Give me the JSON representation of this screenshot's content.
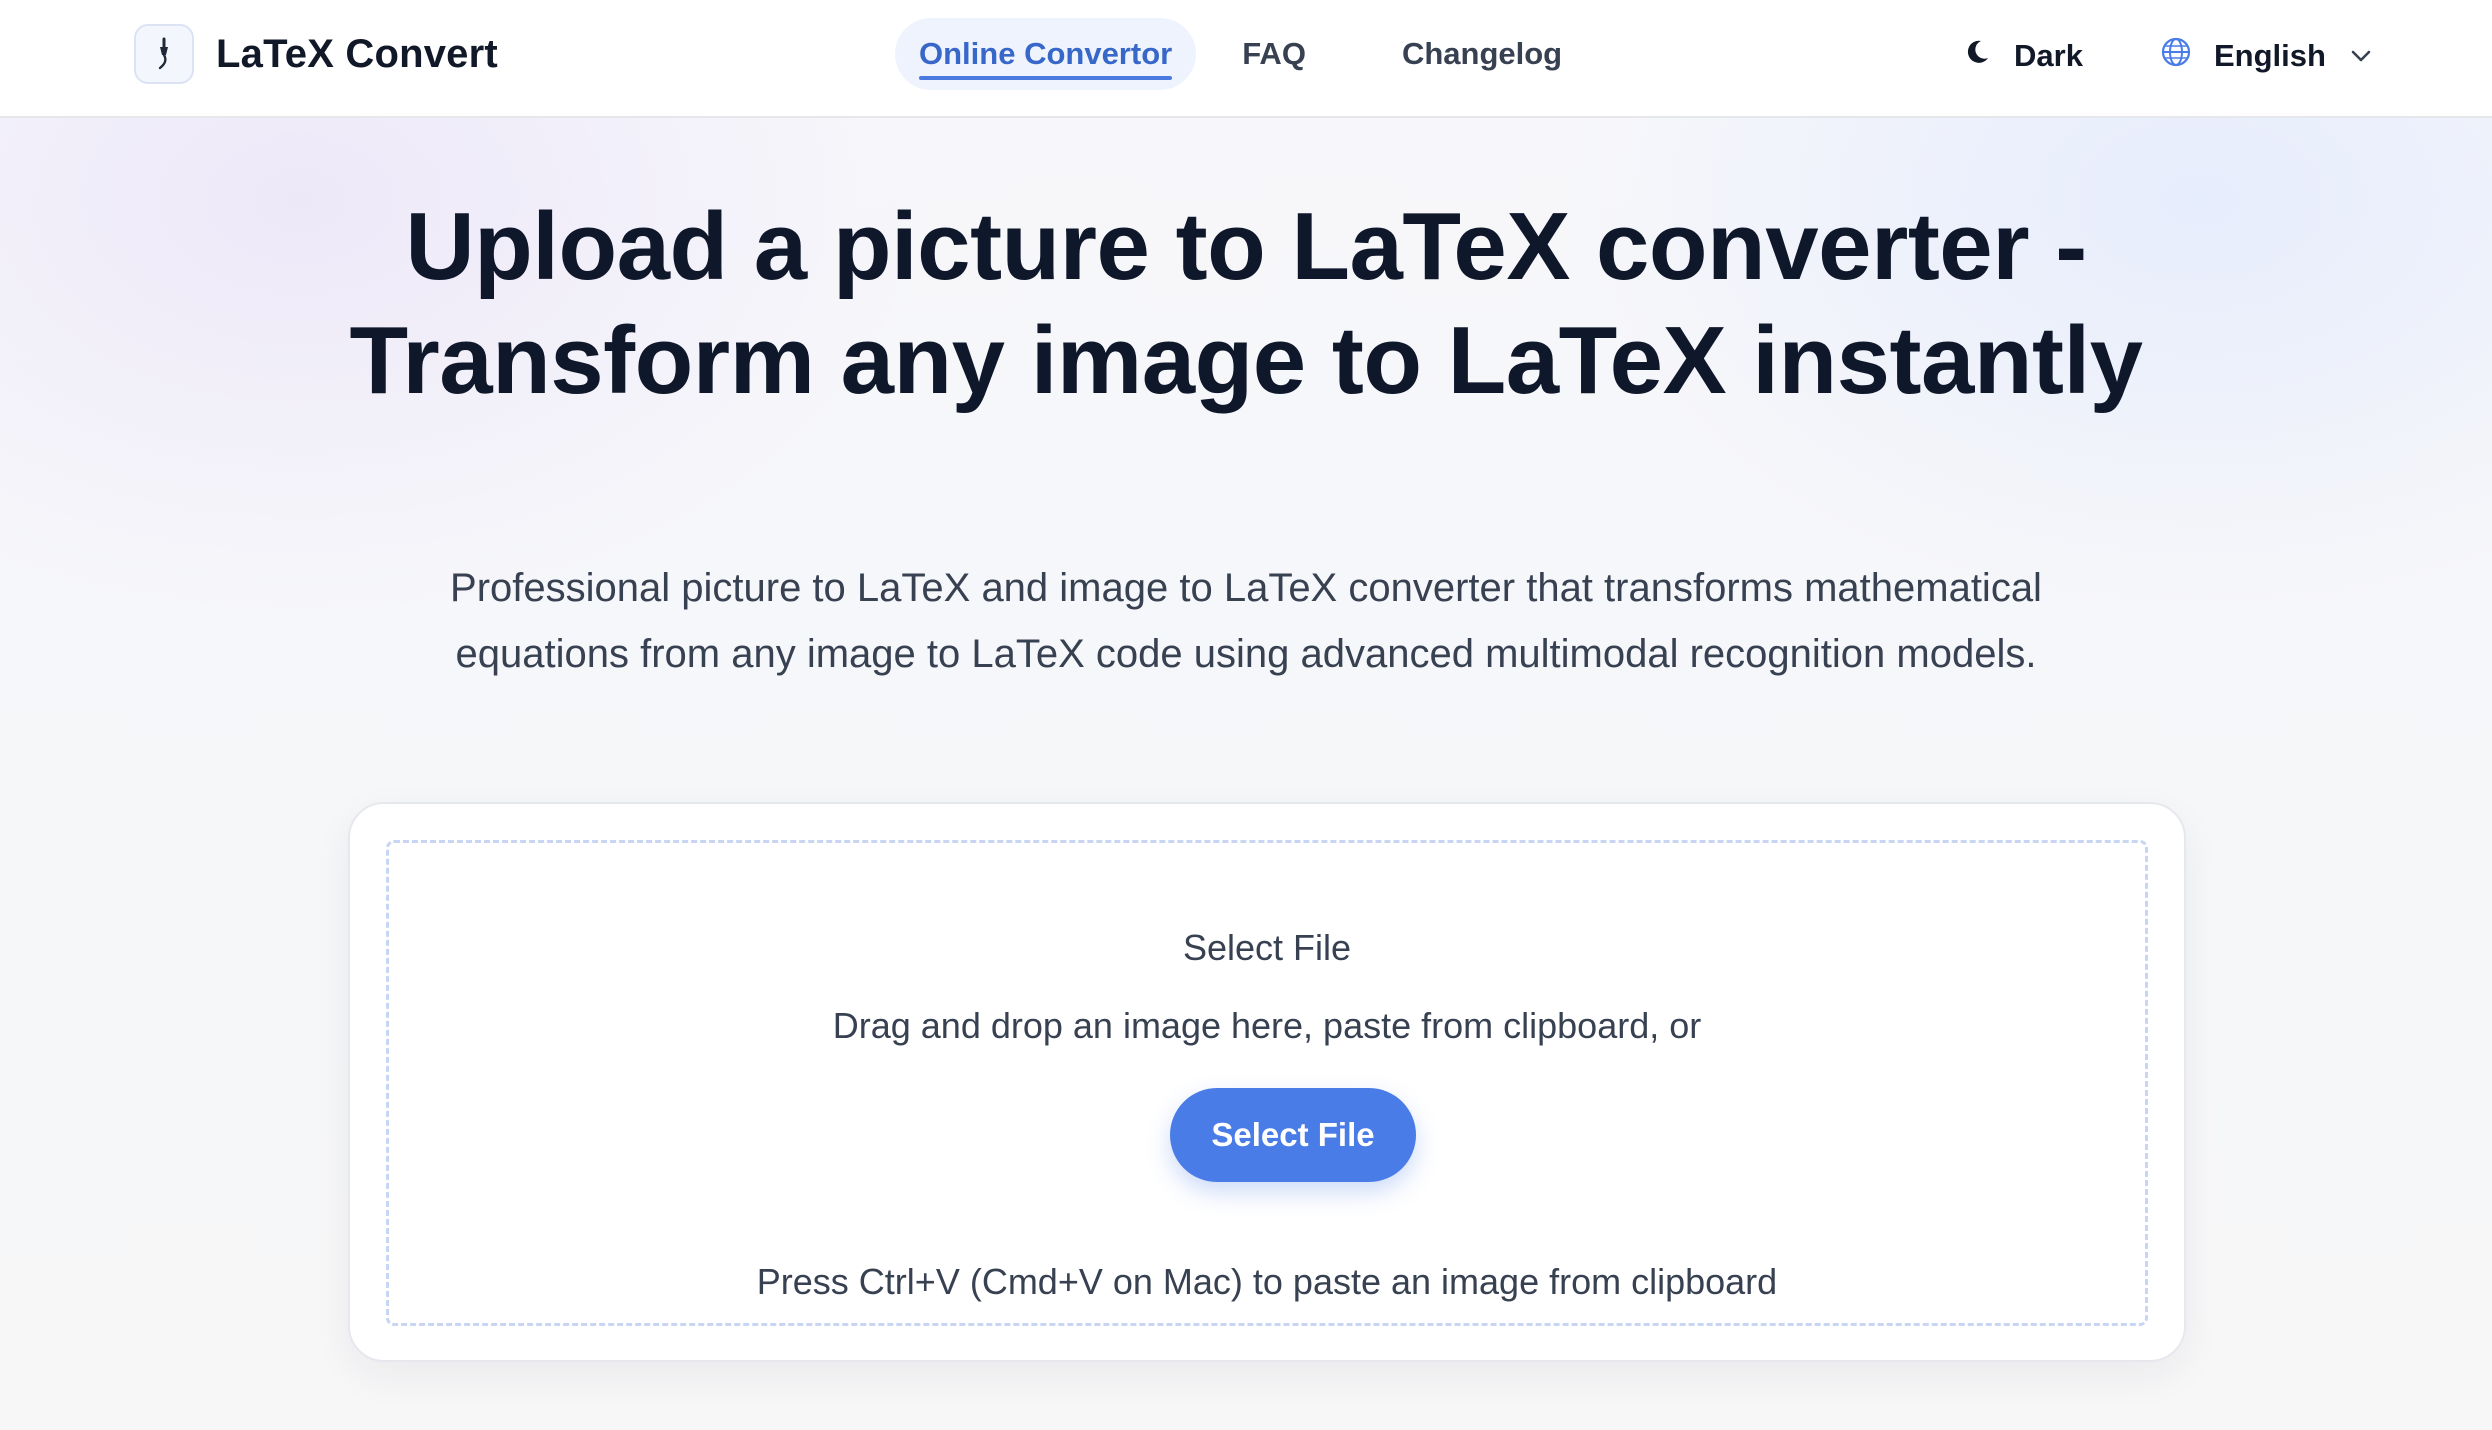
{
  "header": {
    "brand_name": "LaTeX Convert",
    "nav": [
      {
        "label": "Online Convertor",
        "active": true
      },
      {
        "label": "FAQ",
        "active": false
      },
      {
        "label": "Changelog",
        "active": false
      }
    ],
    "theme_label": "Dark",
    "language_label": "English"
  },
  "hero": {
    "title": "Upload a picture to LaTeX converter - Transform any image to LaTeX instantly",
    "subtitle": "Professional picture to LaTeX and image to LaTeX converter that transforms mathematical equations from any image to LaTeX code using advanced multimodal recognition models."
  },
  "upload": {
    "title": "Select File",
    "description": "Drag and drop an image here, paste from clipboard, or",
    "button_label": "Select File",
    "hint": "Press Ctrl+V (Cmd+V on Mac) to paste an image from clipboard"
  },
  "icons": {
    "brand": "fountain-pen-icon",
    "theme": "moon-icon",
    "language": "globe-icon",
    "dropdown": "chevron-down-icon"
  },
  "colors": {
    "accent": "#4a7ce8",
    "active_nav_text": "#3767c9",
    "active_nav_bg": "#eef3fd"
  }
}
